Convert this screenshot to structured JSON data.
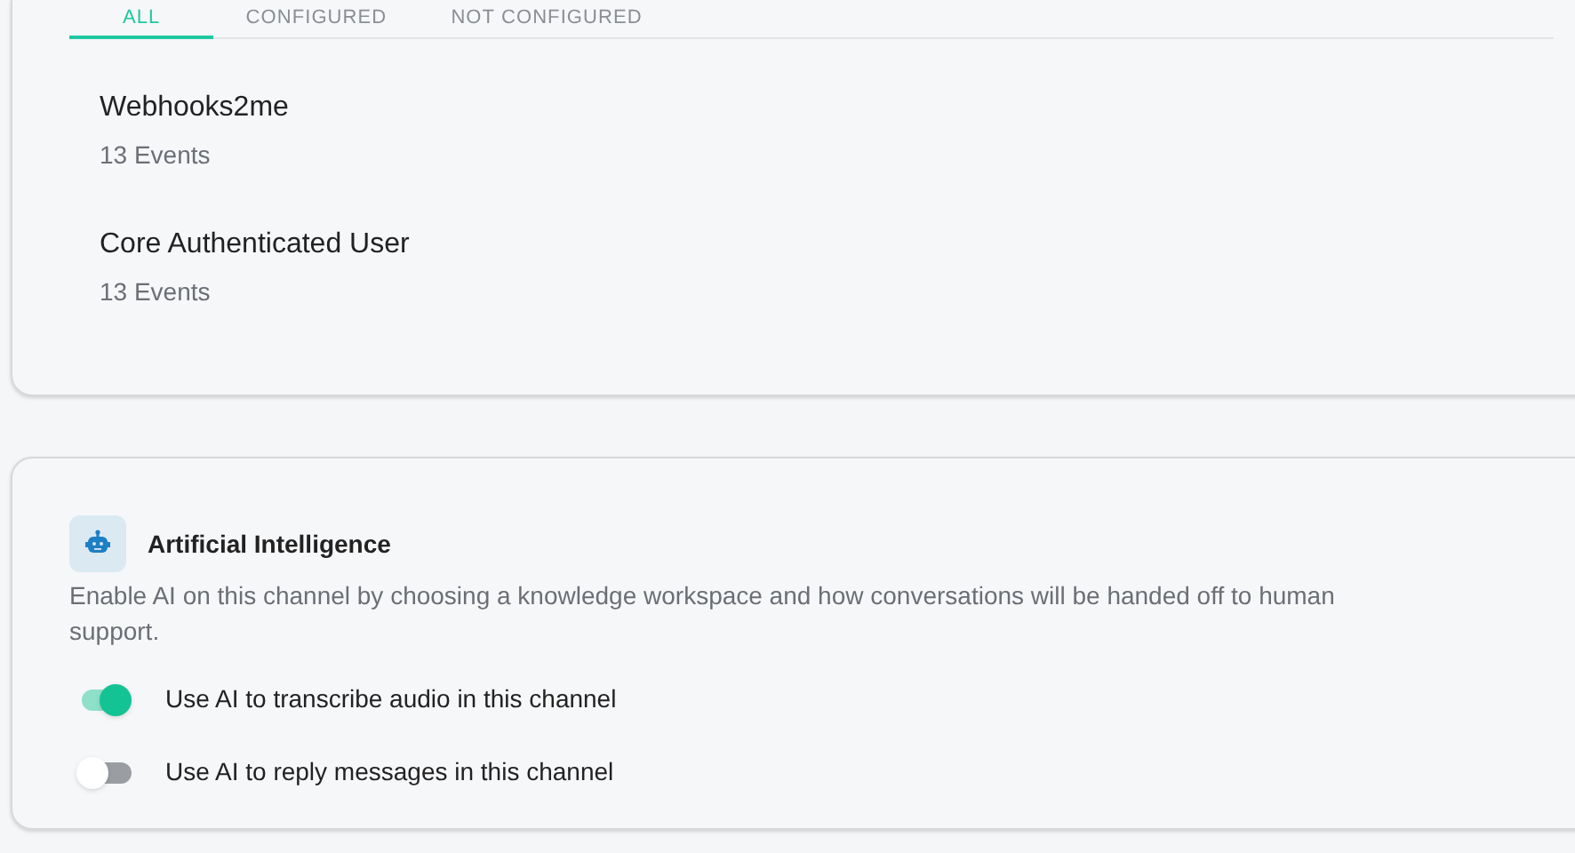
{
  "tabs": [
    {
      "label": "ALL",
      "selected": true
    },
    {
      "label": "CONFIGURED",
      "selected": false
    },
    {
      "label": "NOT CONFIGURED",
      "selected": false
    }
  ],
  "integrations": [
    {
      "name": "Webhooks2me",
      "events": "13 Events"
    },
    {
      "name": "Core Authenticated User",
      "events": "13 Events"
    }
  ],
  "ai_section": {
    "title": "Artificial Intelligence",
    "description": "Enable AI on this channel by choosing a knowledge workspace and how conversations will be handed off to human support.",
    "toggles": [
      {
        "label": "Use AI to transcribe audio in this channel",
        "on": true
      },
      {
        "label": "Use AI to reply messages in this channel",
        "on": false
      }
    ]
  }
}
